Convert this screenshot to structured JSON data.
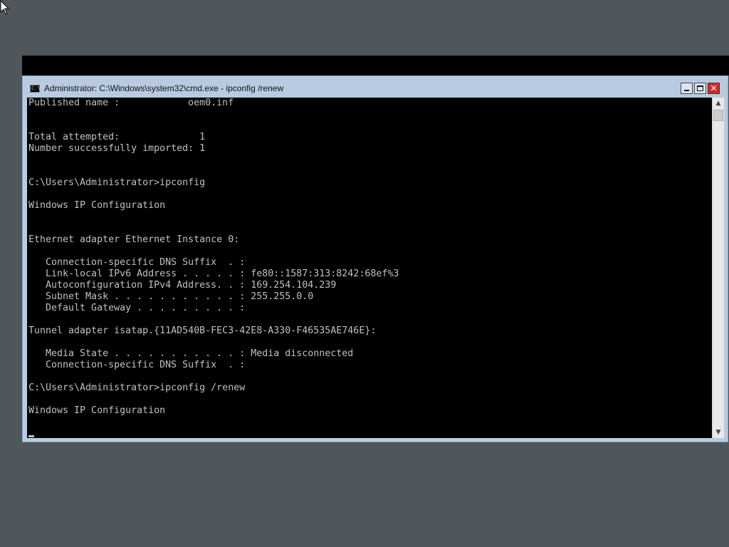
{
  "window": {
    "title": "Administrator: C:\\Windows\\system32\\cmd.exe - ipconfig  /renew",
    "icon": "cmd-icon",
    "icon_label": "C:\\",
    "close_glyph": "✕"
  },
  "console": {
    "lines": [
      "Published name :            oem0.inf",
      "",
      "",
      "Total attempted:              1",
      "Number successfully imported: 1",
      "",
      "",
      "C:\\Users\\Administrator>ipconfig",
      "",
      "Windows IP Configuration",
      "",
      "",
      "Ethernet adapter Ethernet Instance 0:",
      "",
      "   Connection-specific DNS Suffix  . :",
      "   Link-local IPv6 Address . . . . . : fe80::1587:313:8242:68ef%3",
      "   Autoconfiguration IPv4 Address. . : 169.254.104.239",
      "   Subnet Mask . . . . . . . . . . . : 255.255.0.0",
      "   Default Gateway . . . . . . . . . :",
      "",
      "Tunnel adapter isatap.{11AD540B-FEC3-42E8-A330-F46535AE746E}:",
      "",
      "   Media State . . . . . . . . . . . : Media disconnected",
      "   Connection-specific DNS Suffix  . :",
      "",
      "C:\\Users\\Administrator>ipconfig /renew",
      "",
      "Windows IP Configuration"
    ]
  },
  "scrollbar": {
    "up_glyph": "▲",
    "down_glyph": "▼"
  },
  "colors": {
    "desktop": "#4f565c",
    "titlebar": "#b9cbe0",
    "console_bg": "#000000",
    "console_text": "#c0c0c0",
    "close_button": "#c4312a"
  }
}
